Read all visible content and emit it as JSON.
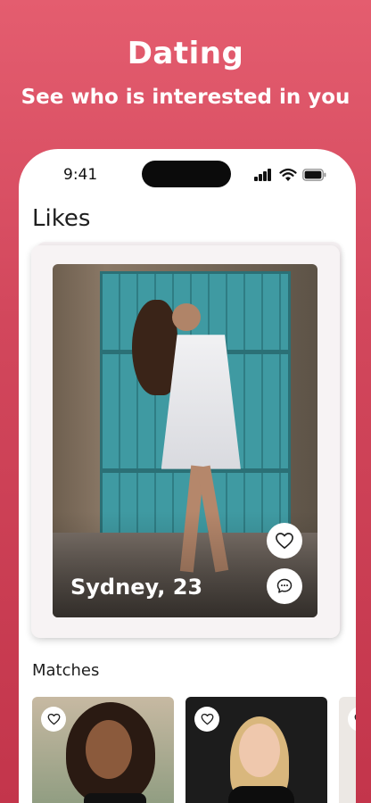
{
  "promo": {
    "title": "Dating",
    "subtitle": "See who is interested in you"
  },
  "status_bar": {
    "time": "9:41",
    "icons": [
      "signal-icon",
      "wifi-icon",
      "battery-icon"
    ]
  },
  "likes": {
    "title": "Likes",
    "card": {
      "name_age": "Sydney, 23",
      "actions": [
        "heart-icon",
        "chat-icon"
      ]
    }
  },
  "matches": {
    "title": "Matches",
    "items": [
      {
        "action": "heart-icon"
      },
      {
        "action": "heart-icon"
      },
      {
        "action": "heart-icon"
      }
    ]
  },
  "colors": {
    "brand_gradient_top": "#e45d6f",
    "brand_gradient_bottom": "#c3354b",
    "card_background": "#f7f3f4"
  }
}
